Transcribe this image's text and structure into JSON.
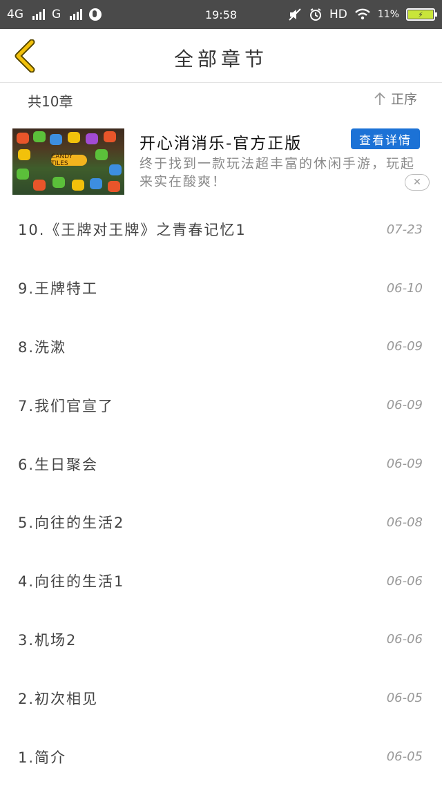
{
  "status_bar": {
    "network_1": "4G",
    "network_2": "G",
    "time": "19:58",
    "hd": "HD",
    "battery_percent": "11%"
  },
  "header": {
    "title": "全部章节"
  },
  "summary": {
    "count_text": "共10章",
    "sort_label": "正序"
  },
  "ad": {
    "thumb_text": "CANDY TILES",
    "title": "开心消消乐-官方正版",
    "detail_button": "查看详情",
    "description": "终于找到一款玩法超丰富的休闲手游，玩起来实在酸爽！",
    "close_symbol": "✕"
  },
  "chapters": [
    {
      "title": "10.《王牌对王牌》之青春记忆1",
      "date": "07-23"
    },
    {
      "title": "9.王牌特工",
      "date": "06-10"
    },
    {
      "title": "8.洗漱",
      "date": "06-09"
    },
    {
      "title": "7.我们官宣了",
      "date": "06-09"
    },
    {
      "title": "6.生日聚会",
      "date": "06-09"
    },
    {
      "title": "5.向往的生活2",
      "date": "06-08"
    },
    {
      "title": "4.向往的生活1",
      "date": "06-06"
    },
    {
      "title": "3.机场2",
      "date": "06-06"
    },
    {
      "title": "2.初次相见",
      "date": "06-05"
    },
    {
      "title": "1.简介",
      "date": "06-05"
    }
  ],
  "colors": {
    "status_bar_bg": "#4a4a4a",
    "back_arrow": "#f2c10b",
    "ad_button": "#1c72d6"
  },
  "icons": {
    "back": "chevron-left-icon",
    "sort": "arrow-up-icon",
    "close": "close-icon"
  }
}
